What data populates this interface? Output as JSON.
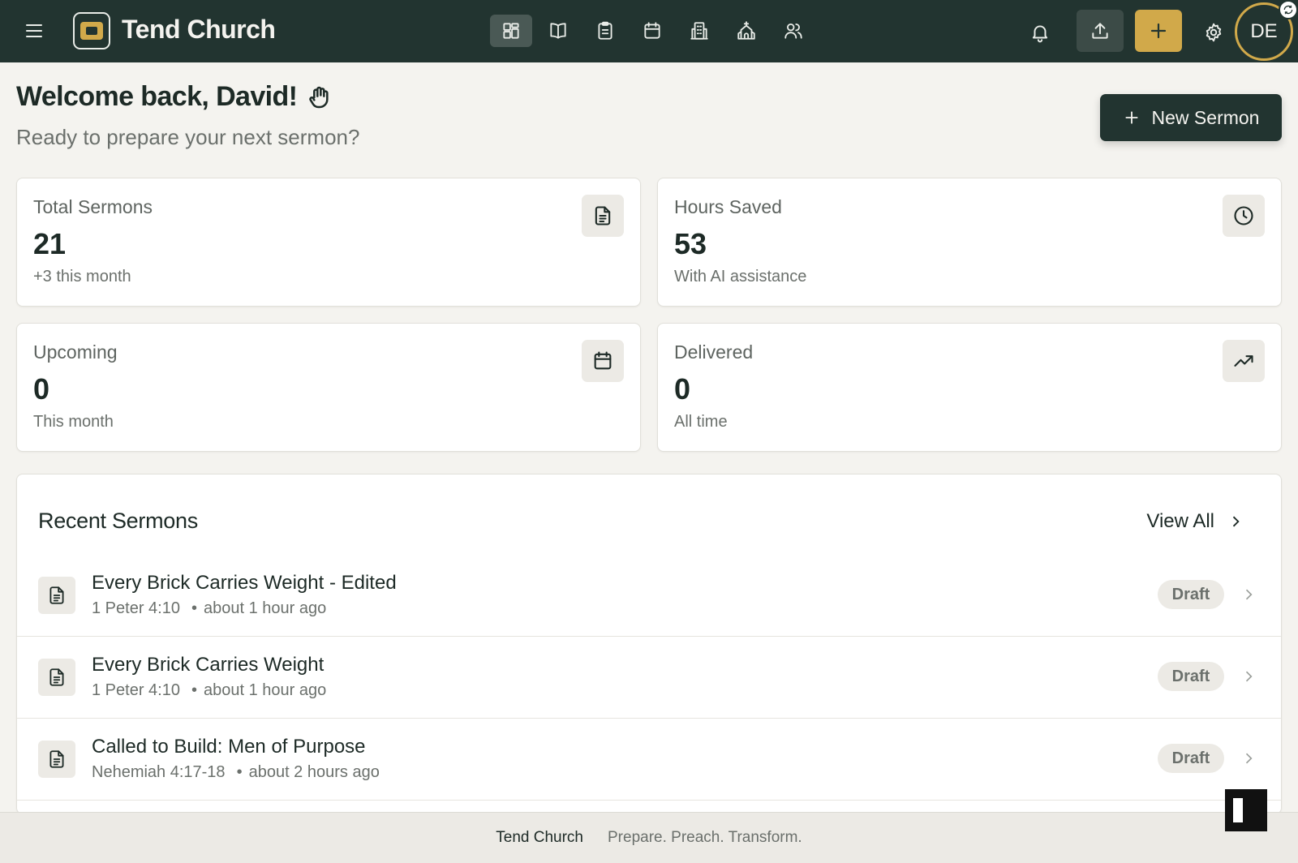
{
  "app": {
    "title": "Tend Church"
  },
  "user": {
    "initials": "DE"
  },
  "header": {
    "welcome": "Welcome back, David!",
    "subtitle": "Ready to prepare your next sermon?",
    "new_sermon_label": "New Sermon"
  },
  "nav": [
    {
      "icon": "dashboard-grid-icon",
      "active": true
    },
    {
      "icon": "open-book-icon",
      "active": false
    },
    {
      "icon": "clipboard-icon",
      "active": false
    },
    {
      "icon": "calendar-icon",
      "active": false
    },
    {
      "icon": "building-icon",
      "active": false
    },
    {
      "icon": "church-icon",
      "active": false
    },
    {
      "icon": "users-icon",
      "active": false
    }
  ],
  "stats": [
    {
      "label": "Total Sermons",
      "value": "21",
      "sub": "+3 this month",
      "icon": "document-icon"
    },
    {
      "label": "Hours Saved",
      "value": "53",
      "sub": "With AI assistance",
      "icon": "clock-icon"
    },
    {
      "label": "Upcoming",
      "value": "0",
      "sub": "This month",
      "icon": "calendar-icon"
    },
    {
      "label": "Delivered",
      "value": "0",
      "sub": "All time",
      "icon": "trending-up-icon"
    }
  ],
  "recent": {
    "title": "Recent Sermons",
    "view_all": "View All",
    "items": [
      {
        "title": "Every Brick Carries Weight - Edited",
        "passage": "1 Peter 4:10",
        "dot": "•",
        "time": "about 1 hour ago",
        "status": "Draft"
      },
      {
        "title": "Every Brick Carries Weight",
        "passage": "1 Peter 4:10",
        "dot": "•",
        "time": "about 1 hour ago",
        "status": "Draft"
      },
      {
        "title": "Called to Build: Men of Purpose",
        "passage": "Nehemiah 4:17-18",
        "dot": "•",
        "time": "about 2 hours ago",
        "status": "Draft"
      }
    ]
  },
  "footer": {
    "brand": "Tend Church",
    "tagline": "Prepare. Preach. Transform."
  },
  "colors": {
    "header_bg": "#223430",
    "accent": "#d1a94a",
    "page_bg": "#f4f3ef"
  }
}
